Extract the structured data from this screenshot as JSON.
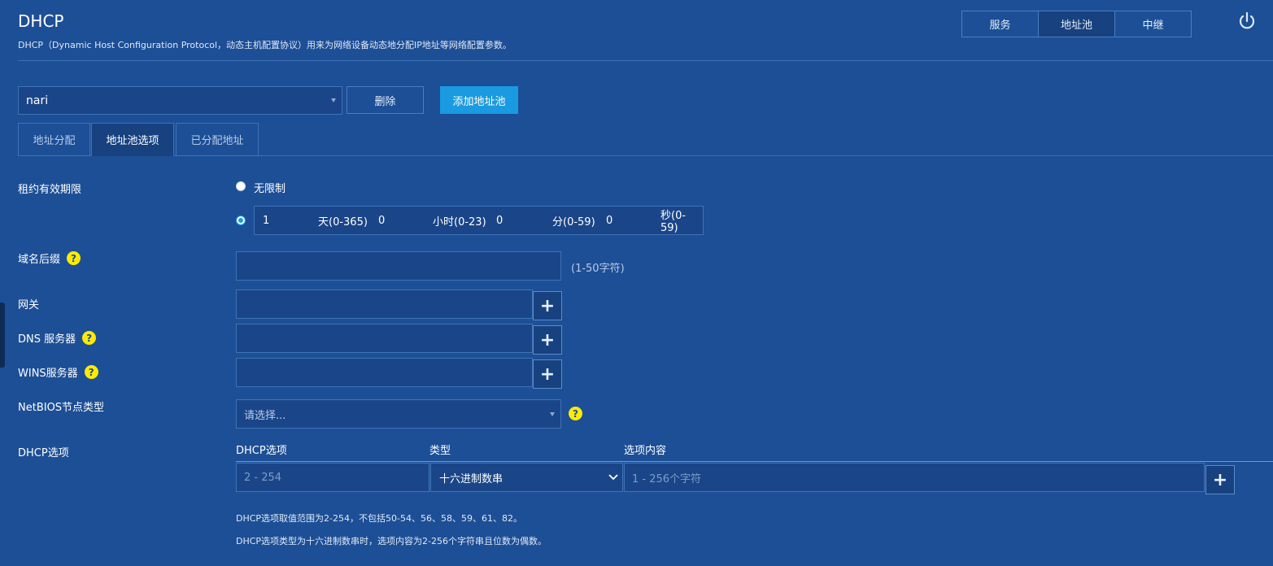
{
  "header": {
    "title": "DHCP",
    "subtitle": "DHCP（Dynamic Host Configuration Protocol，动态主机配置协议）用来为网络设备动态地分配IP地址等网络配置参数。",
    "segments": [
      "服务",
      "地址池",
      "中继"
    ],
    "active_segment": "地址池"
  },
  "toolbar": {
    "pool_value": "nari",
    "delete_label": "删除",
    "add_label": "添加地址池"
  },
  "tabs": [
    {
      "label": "地址分配"
    },
    {
      "label": "地址池选项"
    },
    {
      "label": "已分配地址"
    }
  ],
  "form": {
    "lease": {
      "label": "租约有效期限",
      "unlimited_label": "无限制",
      "days_value": "1",
      "days_unit": "天(0-365)",
      "hours_value": "0",
      "hours_unit": "小时(0-23)",
      "minutes_value": "0",
      "minutes_unit": "分(0-59)",
      "seconds_value": "0",
      "seconds_unit": "秒(0-59)"
    },
    "domain": {
      "label": "域名后缀",
      "hint": "(1-50字符)",
      "value": ""
    },
    "gateway": {
      "label": "网关",
      "value": ""
    },
    "dns": {
      "label": "DNS 服务器",
      "value": ""
    },
    "wins": {
      "label": "WINS服务器",
      "value": ""
    },
    "netbios": {
      "label": "NetBIOS节点类型",
      "placeholder": "请选择..."
    },
    "dhcp_options": {
      "label": "DHCP选项",
      "columns": [
        "DHCP选项",
        "类型",
        "选项内容"
      ],
      "option_placeholder": "2 - 254",
      "type_value": "十六进制数串",
      "content_placeholder": "1 - 256个字符",
      "notes": [
        "DHCP选项取值范围为2-254，不包括50-54、56、58、59、61、82。",
        "DHCP选项类型为十六进制数串时，选项内容为2-256个字符串且位数为偶数。"
      ]
    }
  },
  "icons": {
    "help": "?",
    "plus": "+"
  },
  "colors": {
    "background": "#1d4f96",
    "accent": "#1a9ae0",
    "help": "#ffea00"
  }
}
